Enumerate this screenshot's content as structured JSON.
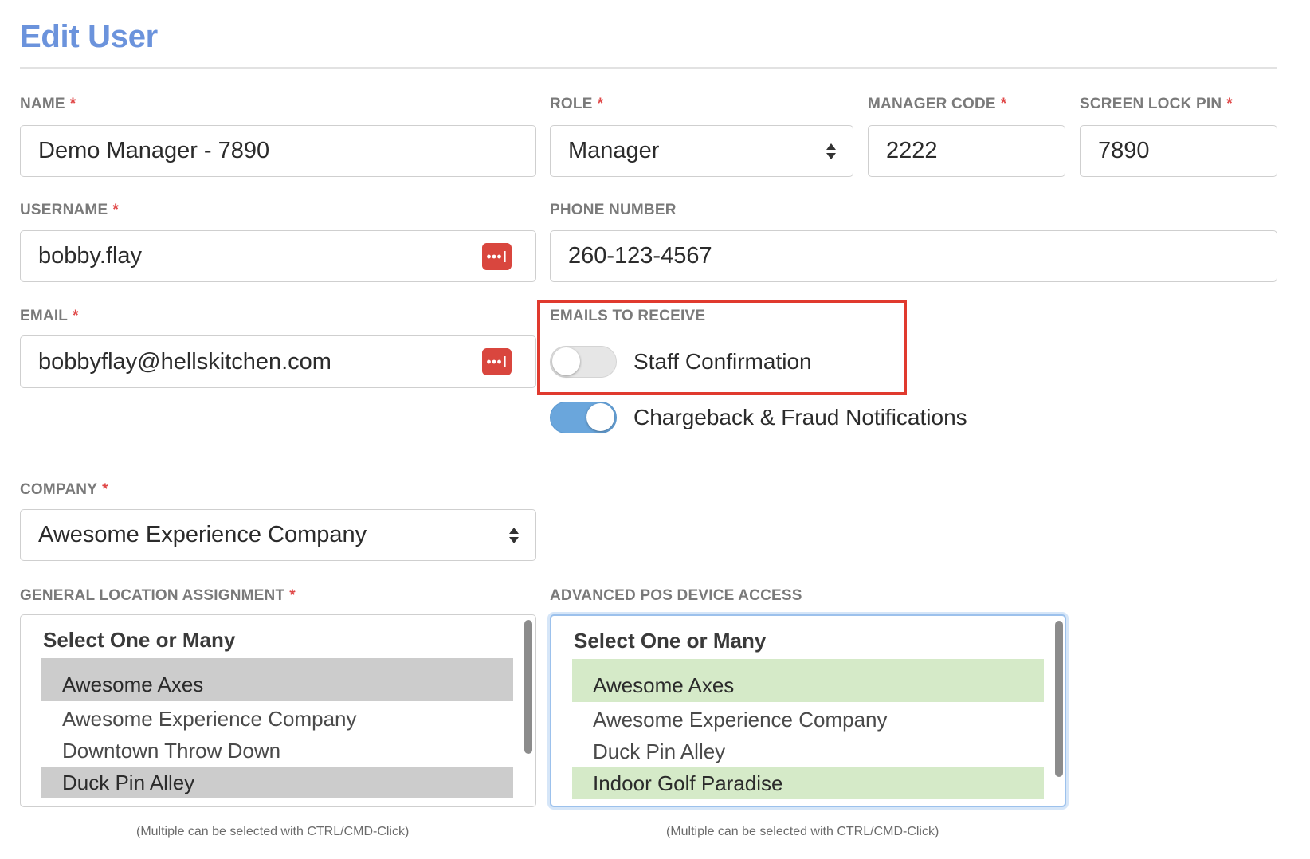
{
  "page": {
    "title": "Edit User"
  },
  "form": {
    "name": {
      "label": "NAME",
      "value": "Demo Manager - 7890"
    },
    "role": {
      "label": "ROLE",
      "value": "Manager"
    },
    "manager_code": {
      "label": "MANAGER CODE",
      "value": "2222"
    },
    "screen_lock_pin": {
      "label": "SCREEN LOCK PIN",
      "value": "7890"
    },
    "username": {
      "label": "USERNAME",
      "value": "bobby.flay"
    },
    "phone_number": {
      "label": "PHONE NUMBER",
      "value": "260-123-4567"
    },
    "email": {
      "label": "EMAIL",
      "value": "bobbyflay@hellskitchen.com"
    },
    "company": {
      "label": "COMPANY",
      "value": "Awesome Experience Company"
    },
    "required_marker": "*"
  },
  "emails_to_receive": {
    "label": "EMAILS TO RECEIVE",
    "toggles": [
      {
        "label": "Staff Confirmation",
        "on": false
      },
      {
        "label": "Chargeback & Fraud Notifications",
        "on": true
      }
    ]
  },
  "general_location": {
    "label": "GENERAL LOCATION ASSIGNMENT",
    "header": "Select One or Many",
    "options": [
      {
        "label": "Awesome Axes",
        "selected": true
      },
      {
        "label": "Awesome Experience Company",
        "selected": false
      },
      {
        "label": "Downtown Throw Down",
        "selected": false
      },
      {
        "label": "Duck Pin Alley",
        "selected": true
      }
    ],
    "hint": "(Multiple can be selected with CTRL/CMD-Click)"
  },
  "advanced_pos": {
    "label": "ADVANCED POS DEVICE ACCESS",
    "header": "Select One or Many",
    "options": [
      {
        "label": "Awesome Axes",
        "selected": true
      },
      {
        "label": "Awesome Experience Company",
        "selected": false
      },
      {
        "label": "Duck Pin Alley",
        "selected": false
      },
      {
        "label": "Indoor Golf Paradise",
        "selected": true
      }
    ],
    "hint": "(Multiple can be selected with CTRL/CMD-Click)"
  },
  "colors": {
    "title": "#6b93dc",
    "required": "#e04848",
    "highlight_border": "#e03a2e",
    "toggle_on": "#6aa6dc",
    "password_icon": "#d9463e",
    "selected_gray": "#cccccc",
    "selected_green": "#d5eac8"
  },
  "icons": {
    "select_arrows": "updown-arrows-icon",
    "password_manager": "password-manager-icon"
  }
}
